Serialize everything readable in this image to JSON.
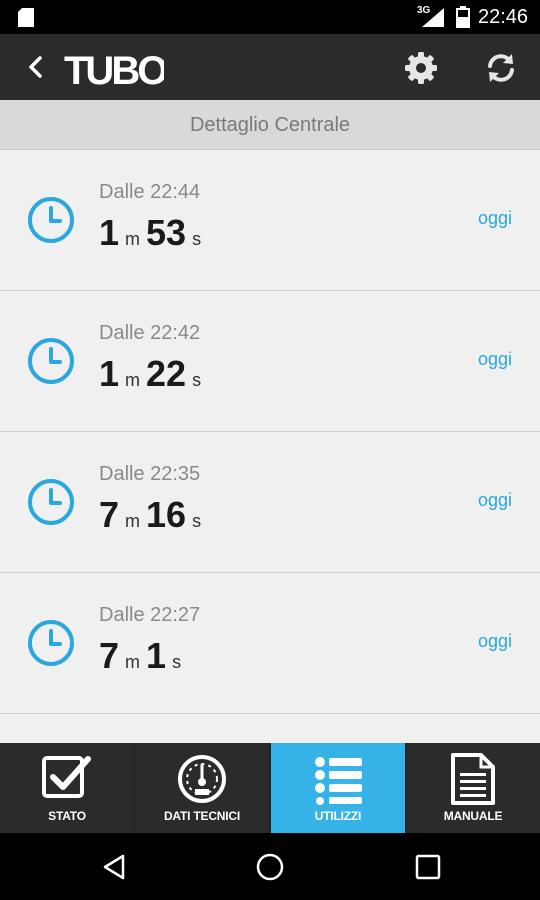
{
  "status_bar": {
    "network": "3G",
    "time": "22:46"
  },
  "app_bar": {
    "logo_text": "TUBO"
  },
  "subheader": {
    "title": "Dettaglio Centrale"
  },
  "usages": [
    {
      "since": "Dalle 22:44",
      "minutes": "1",
      "minutes_unit": "m",
      "seconds": "53",
      "seconds_unit": "s",
      "day": "oggi"
    },
    {
      "since": "Dalle 22:42",
      "minutes": "1",
      "minutes_unit": "m",
      "seconds": "22",
      "seconds_unit": "s",
      "day": "oggi"
    },
    {
      "since": "Dalle 22:35",
      "minutes": "7",
      "minutes_unit": "m",
      "seconds": "16",
      "seconds_unit": "s",
      "day": "oggi"
    },
    {
      "since": "Dalle 22:27",
      "minutes": "7",
      "minutes_unit": "m",
      "seconds": "1",
      "seconds_unit": "s",
      "day": "oggi"
    }
  ],
  "tabs": [
    {
      "label": "STATO",
      "icon": "checkbox-icon",
      "active": false
    },
    {
      "label": "DATI TECNICI",
      "icon": "gauge-icon",
      "active": false
    },
    {
      "label": "UTILIZZI",
      "icon": "list-icon",
      "active": true
    },
    {
      "label": "MANUALE",
      "icon": "document-icon",
      "active": false
    }
  ],
  "colors": {
    "accent": "#35b3e8",
    "bar": "#2b2b2b",
    "list_bg": "#f0f0f0"
  }
}
